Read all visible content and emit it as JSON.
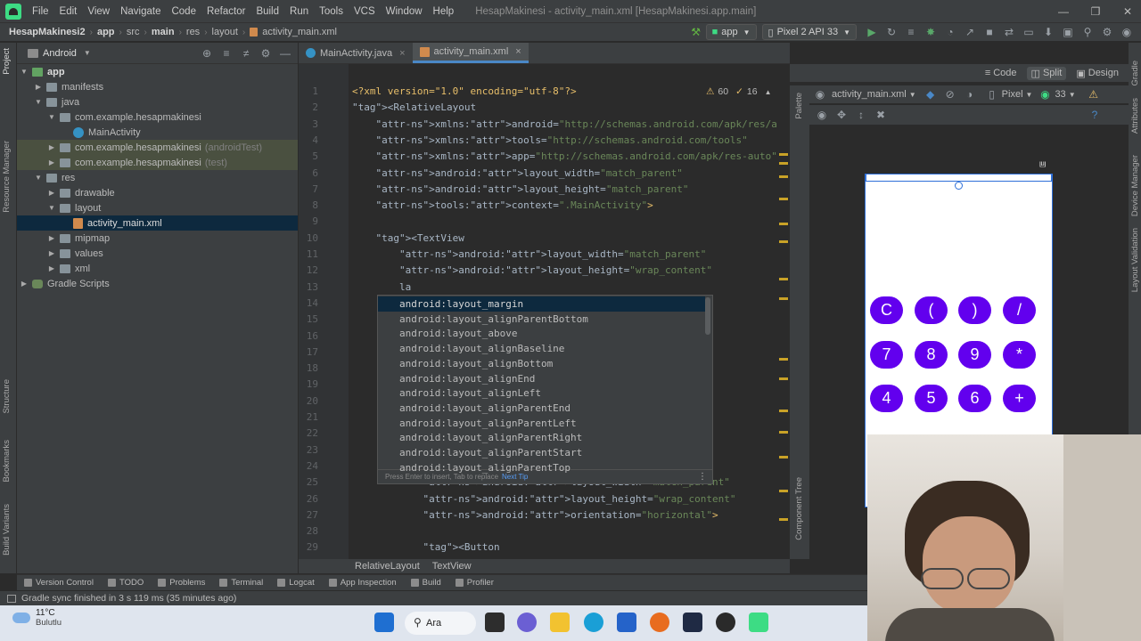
{
  "menubar": {
    "items": [
      "File",
      "Edit",
      "View",
      "Navigate",
      "Code",
      "Refactor",
      "Build",
      "Run",
      "Tools",
      "VCS",
      "Window",
      "Help"
    ],
    "title": "HesapMakinesi - activity_main.xml [HesapMakinesi.app.main]"
  },
  "navbar": {
    "crumbs": [
      "HesapMakinesi2",
      "app",
      "src",
      "main",
      "res",
      "layout",
      "activity_main.xml"
    ],
    "run_config": "app",
    "device": "Pixel 2 API 33"
  },
  "left_stripe": {
    "tabs": [
      "Project",
      "Resource Manager",
      "Structure",
      "Bookmarks",
      "Build Variants"
    ]
  },
  "project_panel": {
    "view_mode": "Android",
    "tree": [
      {
        "label": "app",
        "suffix": ""
      },
      {
        "label": "manifests",
        "suffix": ""
      },
      {
        "label": "java",
        "suffix": ""
      },
      {
        "label": "com.example.hesapmakinesi",
        "suffix": ""
      },
      {
        "label": "MainActivity",
        "suffix": ""
      },
      {
        "label": "com.example.hesapmakinesi",
        "suffix": "(androidTest)"
      },
      {
        "label": "com.example.hesapmakinesi",
        "suffix": "(test)"
      },
      {
        "label": "res",
        "suffix": ""
      },
      {
        "label": "drawable",
        "suffix": ""
      },
      {
        "label": "layout",
        "suffix": ""
      },
      {
        "label": "activity_main.xml",
        "suffix": ""
      },
      {
        "label": "mipmap",
        "suffix": ""
      },
      {
        "label": "values",
        "suffix": ""
      },
      {
        "label": "xml",
        "suffix": ""
      },
      {
        "label": "Gradle Scripts",
        "suffix": ""
      }
    ]
  },
  "editor": {
    "tabs": [
      "MainActivity.java",
      "activity_main.xml"
    ],
    "active_tab": "activity_main.xml",
    "warnings_count": "60",
    "weak_warnings_count": "16",
    "line_numbers": [
      "1",
      "2",
      "3",
      "4",
      "5",
      "6",
      "7",
      "8",
      "9",
      "10",
      "11",
      "12",
      "13",
      "14",
      "15",
      "16",
      "17",
      "18",
      "19",
      "20",
      "21",
      "22",
      "23",
      "24",
      "25",
      "26",
      "27",
      "28",
      "29"
    ],
    "lines": [
      {
        "n": "1",
        "t": "<?xml version=\"1.0\" encoding=\"utf-8\"?>"
      },
      {
        "n": "2",
        "t": "<RelativeLayout"
      },
      {
        "n": "3",
        "t": "    xmlns:android=\"http://schemas.android.com/apk/res/android\""
      },
      {
        "n": "4",
        "t": "    xmlns:tools=\"http://schemas.android.com/tools\""
      },
      {
        "n": "5",
        "t": "    xmlns:app=\"http://schemas.android.com/apk/res-auto\""
      },
      {
        "n": "6",
        "t": "    android:layout_width=\"match_parent\""
      },
      {
        "n": "7",
        "t": "    android:layout_height=\"match_parent\""
      },
      {
        "n": "8",
        "t": "    tools:context=\".MainActivity\">"
      },
      {
        "n": "10",
        "t": "    <TextView"
      },
      {
        "n": "11",
        "t": "        android:layout_width=\"match_parent\""
      },
      {
        "n": "12",
        "t": "        android:layout_height=\"wrap_content\""
      },
      {
        "n": "13",
        "t": "        la"
      },
      {
        "n": "25",
        "t": "            android:layout_width=\"match_parent\""
      },
      {
        "n": "26",
        "t": "            android:layout_height=\"wrap_content\""
      },
      {
        "n": "27",
        "t": "            android:orientation=\"horizontal\">"
      },
      {
        "n": "29",
        "t": "            <Button"
      }
    ]
  },
  "completion": {
    "items": [
      "android:layout_margin",
      "android:layout_alignParentBottom",
      "android:layout_above",
      "android:layout_alignBaseline",
      "android:layout_alignBottom",
      "android:layout_alignEnd",
      "android:layout_alignLeft",
      "android:layout_alignParentEnd",
      "android:layout_alignParentLeft",
      "android:layout_alignParentRight",
      "android:layout_alignParentStart",
      "android:layout_alignParentTop"
    ],
    "footer": "Press Enter to insert, Tab to replace",
    "footer_link": "Next Tip"
  },
  "breadcrumbs_bottom": [
    "RelativeLayout",
    "TextView"
  ],
  "design": {
    "modes": [
      "Code",
      "Split",
      "Design"
    ],
    "active_mode": "Split",
    "file": "activity_main.xml",
    "device": "Pixel",
    "api": "33",
    "palette_label": "Palette",
    "component_tree_label": "Component Tree",
    "buttons": [
      "C",
      "(",
      ")",
      "/",
      "7",
      "8",
      "9",
      "*",
      "4",
      "5",
      "6",
      "+"
    ],
    "button_color": "#6200ee"
  },
  "right_stripe": {
    "tabs": [
      "Gradle",
      "Attributes",
      "Device Manager",
      "Layout Validation"
    ]
  },
  "bottom_tools": [
    "Version Control",
    "TODO",
    "Problems",
    "Terminal",
    "Logcat",
    "App Inspection",
    "Build",
    "Profiler"
  ],
  "status": {
    "message": "Gradle sync finished in 3 s 119 ms (35 minutes ago)"
  },
  "taskbar": {
    "temperature": "11°C",
    "weather": "Bulutlu",
    "search_label": "Ara"
  }
}
